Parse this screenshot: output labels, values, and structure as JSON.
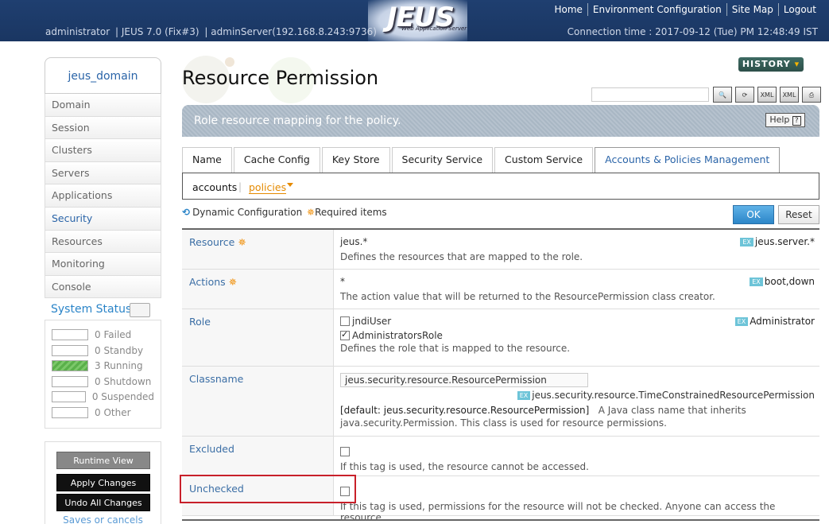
{
  "header": {
    "logo": "JEUS",
    "logo_sub": "Web Application Server",
    "user": "administrator",
    "version": "JEUS 7.0 (Fix#3)",
    "server": "adminServer(192.168.8.243:9736)",
    "connection_time": "Connection time : 2017-09-12 (Tue) PM 12:48:49 IST",
    "nav": [
      "Home",
      "Environment Configuration",
      "Site Map",
      "Logout"
    ]
  },
  "sidebar": {
    "domain": "jeus_domain",
    "items": [
      "Domain",
      "Session",
      "Clusters",
      "Servers",
      "Applications",
      "Security",
      "Resources",
      "Monitoring",
      "Console"
    ],
    "active": "Security",
    "status_title": "System Status",
    "status": [
      {
        "count": "0",
        "label": "Failed",
        "on": false
      },
      {
        "count": "0",
        "label": "Standby",
        "on": false
      },
      {
        "count": "3",
        "label": "Running",
        "on": true
      },
      {
        "count": "0",
        "label": "Shutdown",
        "on": false
      },
      {
        "count": "0",
        "label": "Suspended",
        "on": false
      },
      {
        "count": "0",
        "label": "Other",
        "on": false
      }
    ],
    "runtime_view": "Runtime View",
    "apply_changes": "Apply Changes",
    "undo_changes": "Undo All Changes",
    "saves_link": "Saves or cancels the"
  },
  "main": {
    "title": "Resource Permission",
    "history": "HISTORY",
    "description": "Role resource mapping for the policy.",
    "help": "Help",
    "toolbar_icons": [
      "search-icon",
      "refresh-icon",
      "xml-icon",
      "xml-icon",
      "export-icon"
    ],
    "toolbar_icon_labels": [
      "",
      "",
      "XML",
      "XML",
      ""
    ],
    "tabs": [
      "Name",
      "Cache Config",
      "Key Store",
      "Security Service",
      "Custom Service",
      "Accounts & Policies Management"
    ],
    "active_tab": "Accounts & Policies Management",
    "subtabs": {
      "accounts": "accounts",
      "policies": "policies"
    },
    "dynamic_config": "Dynamic Configuration",
    "required_items": "Required items",
    "ok": "OK",
    "reset": "Reset"
  },
  "form": {
    "resource": {
      "label": "Resource",
      "value": "jeus.*",
      "example": "jeus.server.*",
      "desc": "Defines the resources that are mapped to the role."
    },
    "actions": {
      "label": "Actions",
      "value": "*",
      "example": "boot,down",
      "desc": "The action value that will be returned to the ResourcePermission class creator."
    },
    "role": {
      "label": "Role",
      "options": [
        {
          "name": "jndiUser",
          "checked": false
        },
        {
          "name": "AdministratorsRole",
          "checked": true
        }
      ],
      "example": "Administrator",
      "desc": "Defines the role that is mapped to the resource."
    },
    "classname": {
      "label": "Classname",
      "value": "jeus.security.resource.ResourcePermission",
      "example": "jeus.security.resource.TimeConstrainedResourcePermission",
      "default": "[default: jeus.security.resource.ResourcePermission]",
      "desc": "A Java class name that inherits java.security.Permission. This class is used for resource permissions."
    },
    "excluded": {
      "label": "Excluded",
      "checked": false,
      "desc": "If this tag is used, the resource cannot be accessed."
    },
    "unchecked": {
      "label": "Unchecked",
      "checked": false,
      "desc": "If this tag is used, permissions for the resource will not be checked. Anyone can access the resource."
    }
  },
  "colors": {
    "header_bg": "#1f3f70",
    "accent": "#2a64a8",
    "required": "#f08c00",
    "highlight": "#c8202a",
    "ok_button": "#2c86c8"
  }
}
